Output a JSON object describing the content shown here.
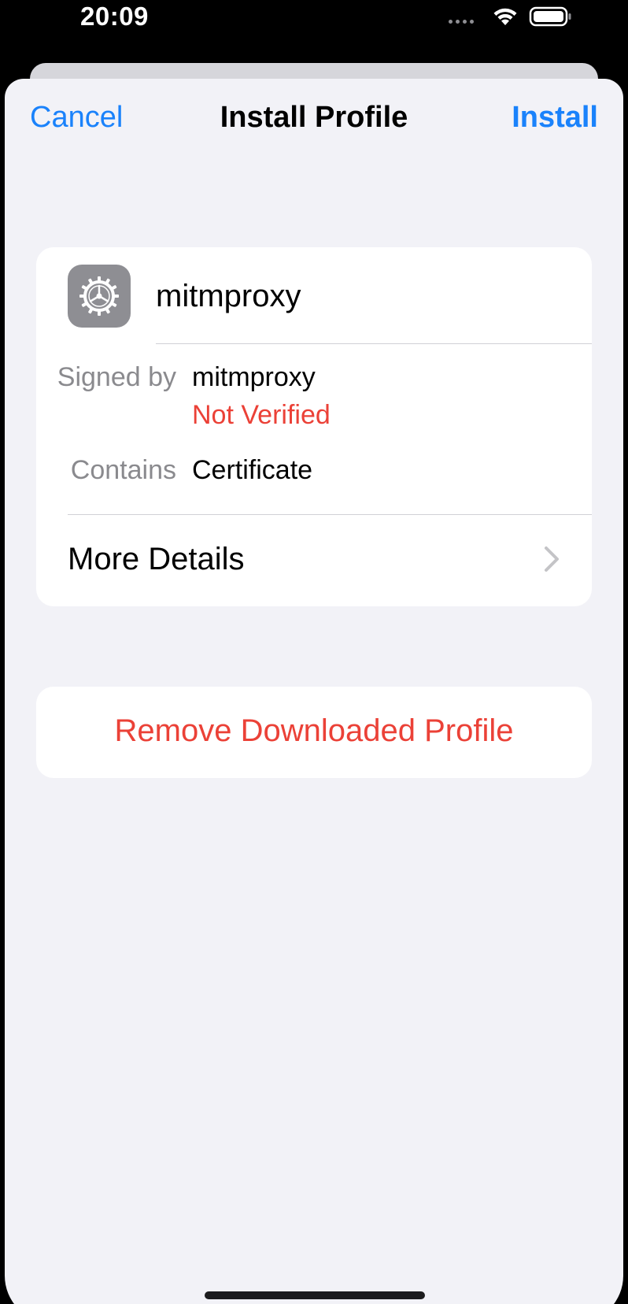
{
  "status_bar": {
    "time": "20:09",
    "icons": [
      "wifi-icon",
      "battery-icon"
    ]
  },
  "nav": {
    "cancel_label": "Cancel",
    "title": "Install Profile",
    "install_label": "Install"
  },
  "profile": {
    "icon": "settings-gear-icon",
    "name": "mitmproxy",
    "signed_by_label": "Signed by",
    "signed_by_value": "mitmproxy",
    "verification_status": "Not Verified",
    "contains_label": "Contains",
    "contains_value": "Certificate",
    "more_details_label": "More Details"
  },
  "actions": {
    "remove_label": "Remove Downloaded Profile"
  },
  "colors": {
    "accent": "#1a82fb",
    "destructive": "#eb4137",
    "background": "#f2f2f7",
    "card": "#ffffff",
    "secondary_text": "#8a8a8e"
  }
}
